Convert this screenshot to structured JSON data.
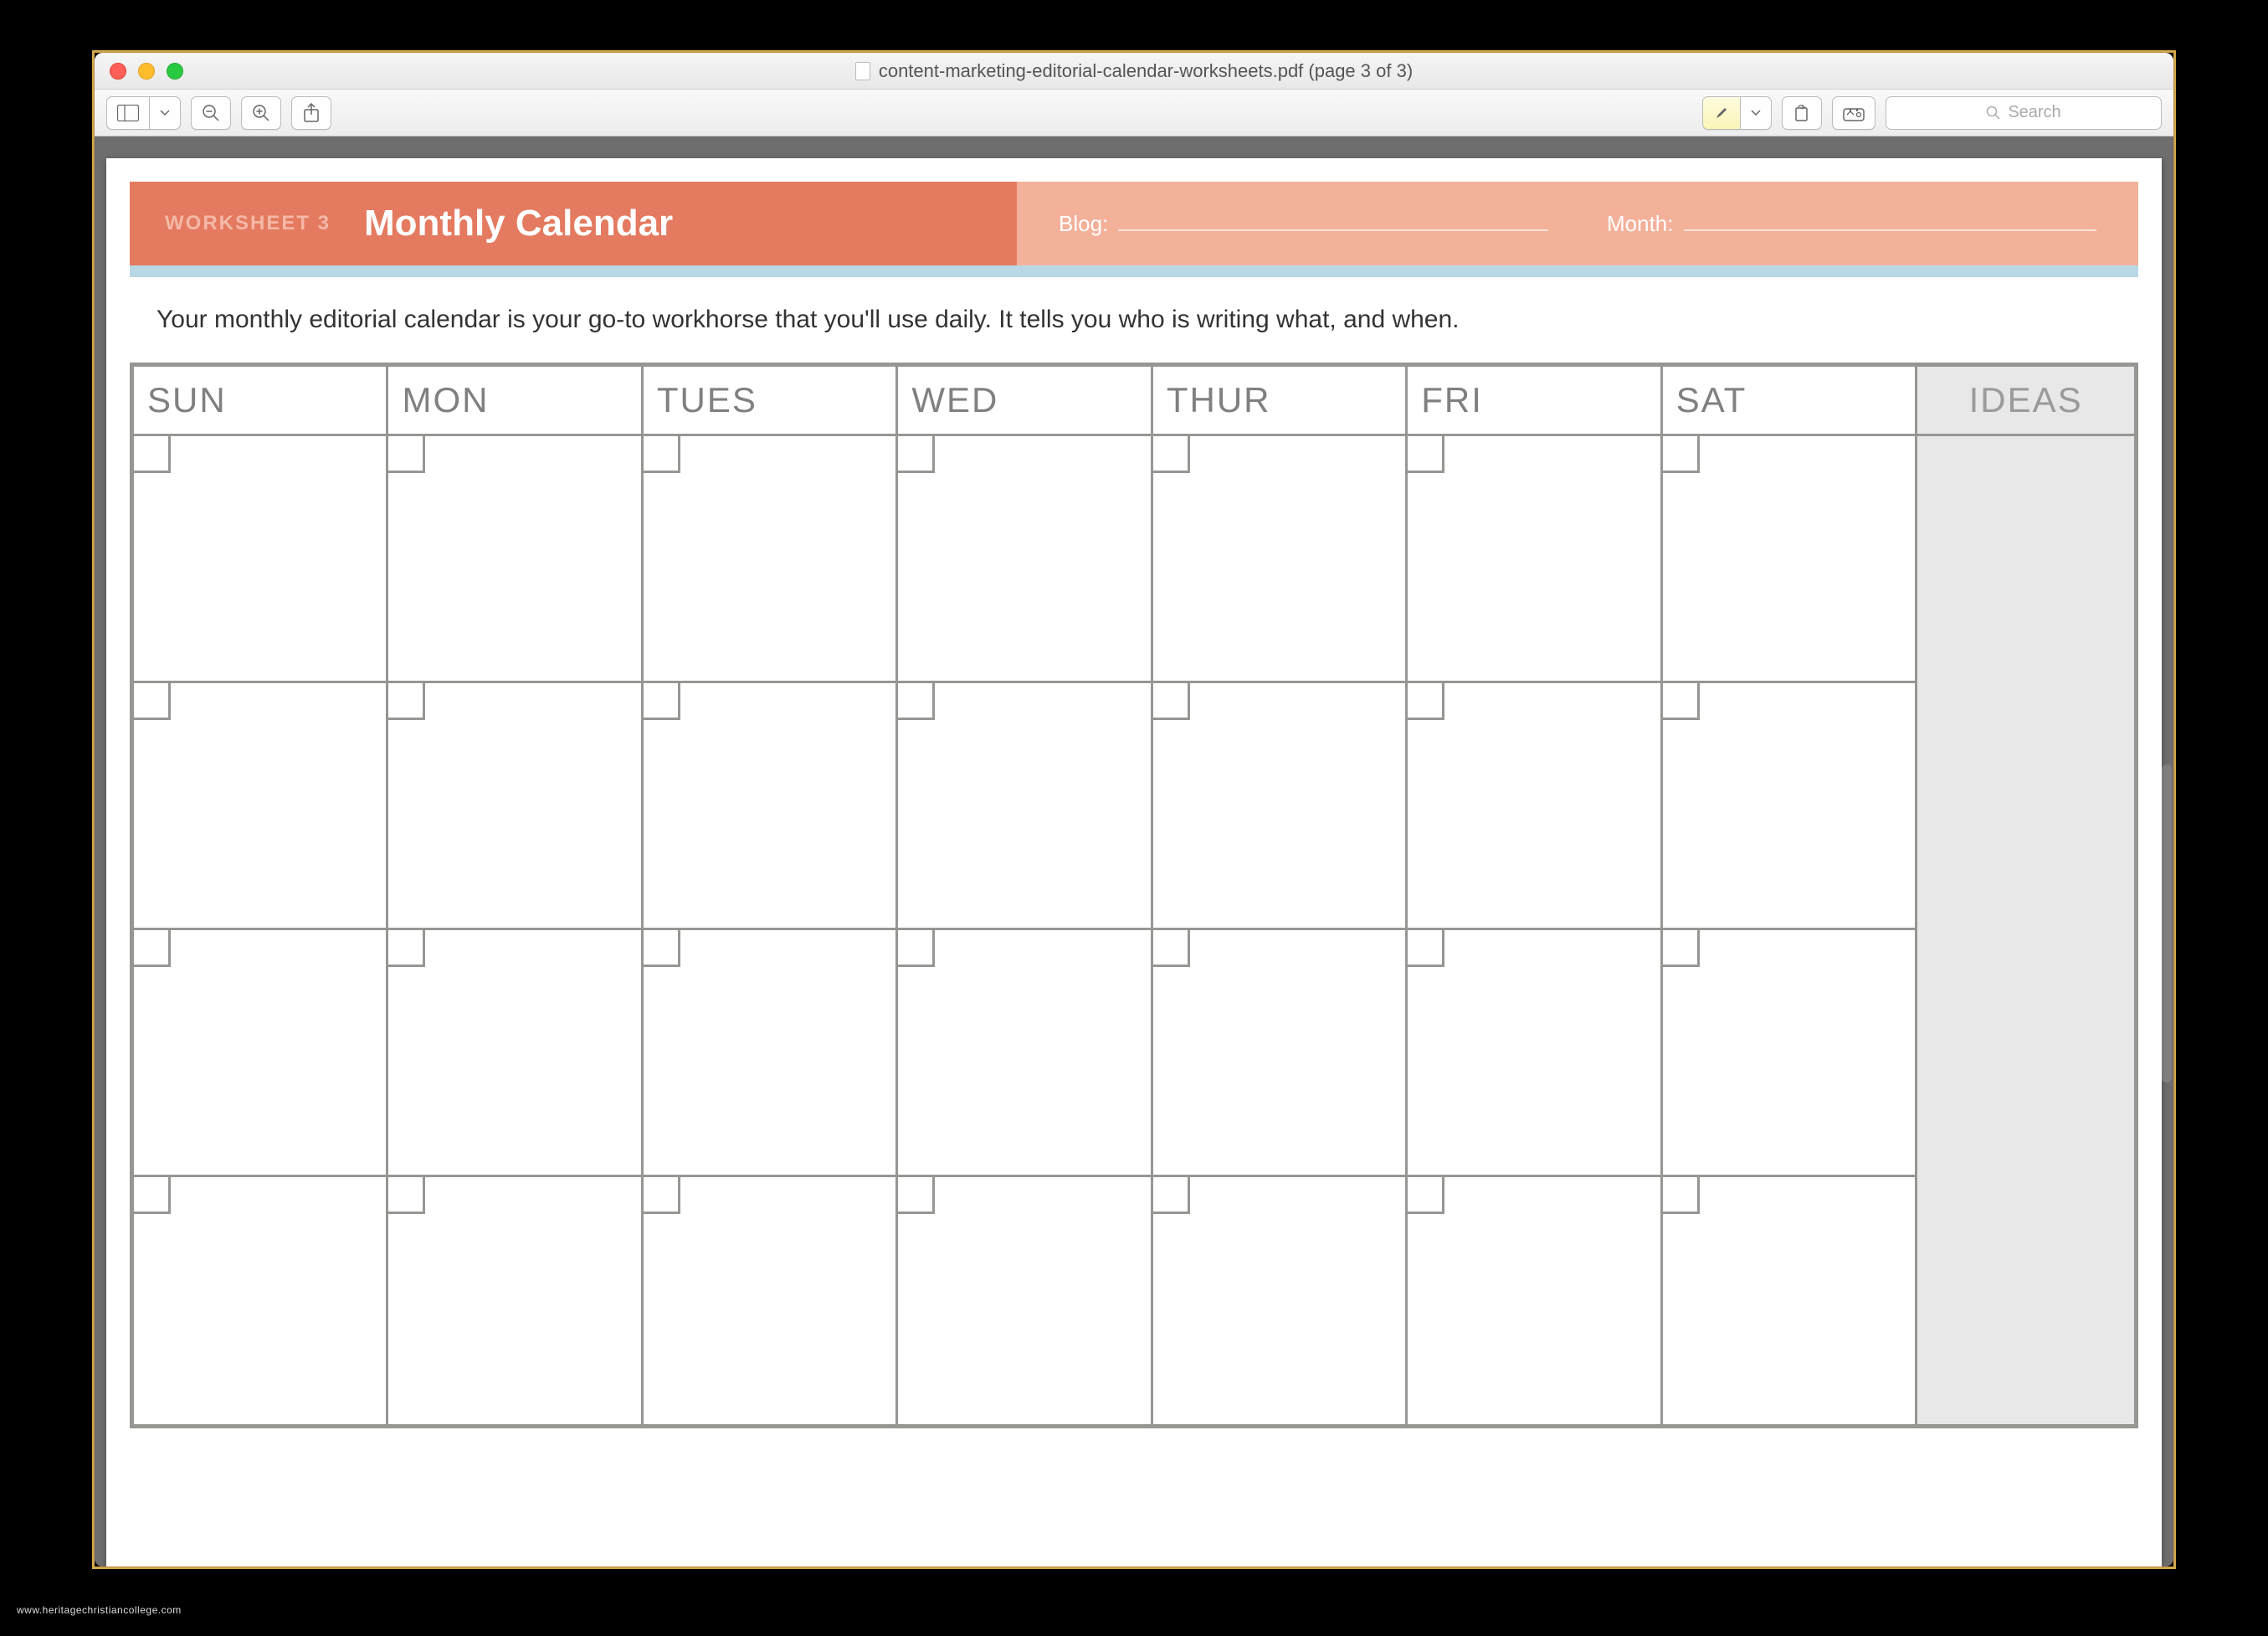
{
  "window": {
    "title": "content-marketing-editorial-calendar-worksheets.pdf (page 3 of 3)"
  },
  "toolbar": {
    "search_placeholder": "Search"
  },
  "worksheet": {
    "label": "WORKSHEET 3",
    "title": "Monthly Calendar",
    "blog_label": "Blog:",
    "month_label": "Month:",
    "intro": "Your monthly editorial calendar is your go-to workhorse that you'll use daily. It tells you who is writing what, and when."
  },
  "calendar": {
    "days": [
      "SUN",
      "MON",
      "TUES",
      "WED",
      "THUR",
      "FRI",
      "SAT"
    ],
    "ideas_label": "IDEAS"
  },
  "watermark": "www.heritagechristiancollege.com"
}
